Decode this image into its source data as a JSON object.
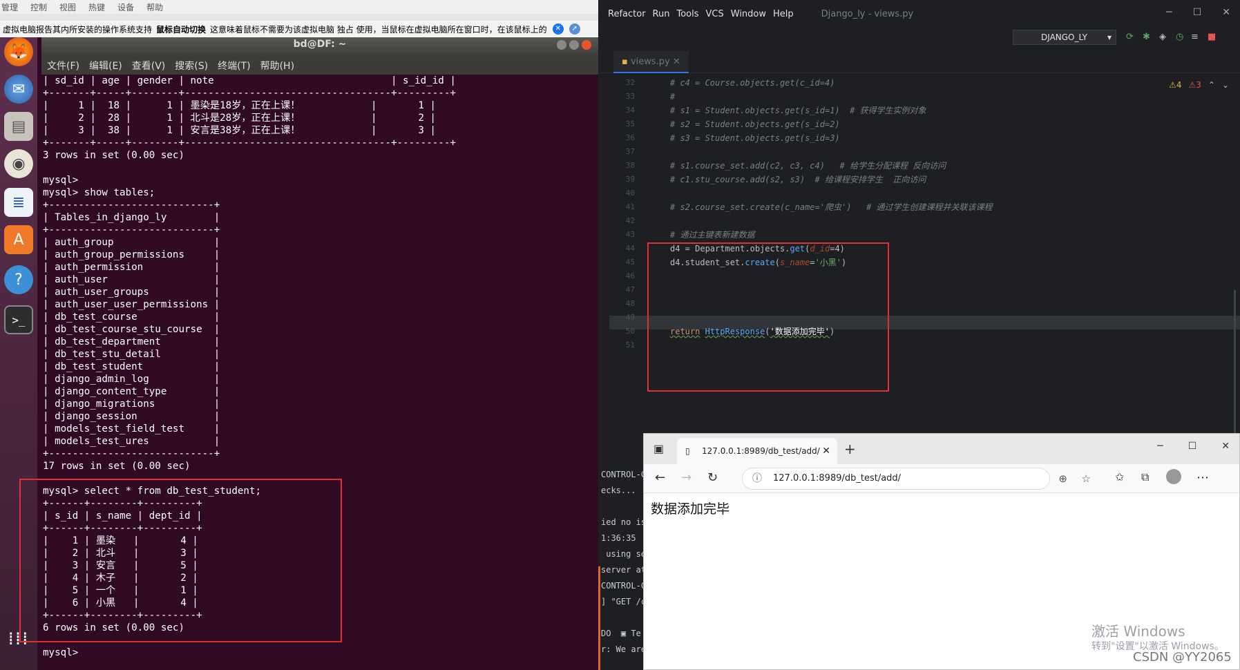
{
  "vm": {
    "menu": [
      "管理",
      "控制",
      "视图",
      "热键",
      "设备",
      "帮助"
    ],
    "notice_pre": "虚拟电脑报告其内所安装的操作系统支持",
    "notice_bold": "鼠标自动切换",
    "notice_post": "这意味着鼠标不需要为该虚拟电脑 独占 使用，当鼠标在虚拟电脑所在窗口时，在该鼠标上的",
    "terminal_title": "bd@DF: ~",
    "terminal_menu": [
      "文件(F)",
      "编辑(E)",
      "查看(V)",
      "搜索(S)",
      "终端(T)",
      "帮助(H)"
    ],
    "launcher_icons": [
      "firefox-icon",
      "thunderbird-icon",
      "files-icon",
      "rhythmbox-icon",
      "writer-icon",
      "software-center-icon",
      "help-icon",
      "terminal-icon",
      "apps-grid-icon"
    ],
    "terminal_lines": [
      "| sd_id | age | gender | note                              | s_id_id |",
      "+-------+-----+--------+-----------------------------------+---------+",
      "|     1 |  18 |      1 | 墨染是18岁，正在上课！            |       1 |",
      "|     2 |  28 |      1 | 北斗是28岁，正在上课！            |       2 |",
      "|     3 |  38 |      1 | 安言是38岁，正在上课！            |       3 |",
      "+-------+-----+--------+-----------------------------------+---------+",
      "3 rows in set (0.00 sec)",
      "",
      "mysql>",
      "mysql> show tables;",
      "+----------------------------+",
      "| Tables_in_django_ly        |",
      "+----------------------------+",
      "| auth_group                 |",
      "| auth_group_permissions     |",
      "| auth_permission            |",
      "| auth_user                  |",
      "| auth_user_groups           |",
      "| auth_user_user_permissions |",
      "| db_test_course             |",
      "| db_test_course_stu_course  |",
      "| db_test_department         |",
      "| db_test_stu_detail         |",
      "| db_test_student            |",
      "| django_admin_log           |",
      "| django_content_type        |",
      "| django_migrations          |",
      "| django_session             |",
      "| models_test_field_test     |",
      "| models_test_ures           |",
      "+----------------------------+",
      "17 rows in set (0.00 sec)",
      "",
      "mysql> select * from db_test_student;",
      "+------+--------+---------+",
      "| s_id | s_name | dept_id |",
      "+------+--------+---------+",
      "|    1 | 墨染   |       4 |",
      "|    2 | 北斗   |       3 |",
      "|    3 | 安言   |       5 |",
      "|    4 | 木子   |       2 |",
      "|    5 | 一个   |       1 |",
      "|    6 | 小黑   |       4 |",
      "+------+--------+---------+",
      "6 rows in set (0.00 sec)",
      "",
      "mysql>"
    ]
  },
  "ide": {
    "menu": [
      "Refactor",
      "Run",
      "Tools",
      "VCS",
      "Window",
      "Help"
    ],
    "title": "Django_ly - views.py",
    "run_config": "DJANGO_LY",
    "tab": "views.py",
    "warnings": "4",
    "errors": "3",
    "line_numbers": [
      "32",
      "33",
      "34",
      "35",
      "36",
      "37",
      "38",
      "39",
      "40",
      "41",
      "42",
      "43",
      "44",
      "45",
      "46",
      "47",
      "48",
      "49",
      "50",
      "51"
    ],
    "code": {
      "l32": "# c4 = Course.objects.get(c_id=4)",
      "l33": "#",
      "l34": "# s1 = Student.objects.get(s_id=1)  # 获得学生实例对象",
      "l35": "# s2 = Student.objects.get(s_id=2)",
      "l36": "# s3 = Student.objects.get(s_id=3)",
      "l38": "# s1.course_set.add(c2, c3, c4)   # 给学生分配课程 反向访问",
      "l39": "# c1.stu_course.add(s2, s3)  # 给课程安排学生  正向访问",
      "l41": "# s2.course_set.create(c_name='爬虫')   # 通过学生创建课程并关联该课程",
      "l43": "# 通过主键表新建数据",
      "l44_a": "d4 = Department.objects.",
      "l44_b": "get",
      "l44_c": "(",
      "l44_d": "d_id",
      "l44_e": "=4)",
      "l45_a": "d4.student_set.",
      "l45_b": "create",
      "l45_c": "(",
      "l45_d": "s_name",
      "l45_e": "=",
      "l45_f": "'小黑'",
      "l45_g": ")",
      "l50_a": "return",
      "l50_b": "HttpResponse",
      "l50_c": "(",
      "l50_d": "'数据添加完毕'",
      "l50_e": ")"
    },
    "console_lines": [
      "CONTROL-C",
      "ecks...",
      "",
      "ied no iss",
      "1:36:35",
      " using se",
      "server at",
      "CONTROL-C",
      "] \"GET /c",
      "",
      "DO  ▣ Te",
      "r: We are a"
    ]
  },
  "browser": {
    "tab_title": "127.0.0.1:8989/db_test/add/",
    "url": "127.0.0.1:8989/db_test/add/",
    "content": "数据添加完毕"
  },
  "watermark": {
    "line1": "激活 Windows",
    "line2": "转到\"设置\"以激活 Windows。",
    "csdn": "CSDN @YY2065"
  }
}
